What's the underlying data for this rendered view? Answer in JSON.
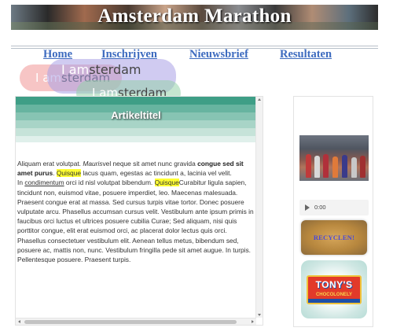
{
  "header": {
    "title": "Amsterdam Marathon"
  },
  "nav": {
    "items": [
      "Home",
      "Inschrijven",
      "Nieuwsbrief",
      "Resultaten"
    ]
  },
  "logo": {
    "prefix": "I am",
    "suffix": "sterdam"
  },
  "article": {
    "title": "Artikeltitel",
    "p1_a": "Aliquam erat volutpat. ",
    "p1_italic": "Mauris",
    "p1_b": "vel neque sit amet nunc gravida ",
    "p1_bold": "congue sed sit amet purus",
    "p1_c": ". ",
    "p1_hl1": "Quisque",
    "p1_d": " lacus quam, egestas ac tincidunt a, lacinia vel velit.",
    "p2_a": "In ",
    "p2_under": "condimentum",
    "p2_b": " orci id nisl volutpat bibendum. ",
    "p2_hl2": "Quisque",
    "p2_c": "Curabitur ligula sapien, tincidunt non, euismod vitae, posuere imperdiet, leo. Maecenas malesuada. Praesent congue erat at massa. Sed cursus turpis vitae tortor. Donec posuere vulputate arcu. Phasellus accumsan cursus velit. Vestibulum ante ipsum primis in faucibus orci luctus et ultrices posuere cubilia Curae; Sed aliquam, nisi quis porttitor congue, elit erat euismod orci, ac placerat dolor lectus quis orci. Phasellus consectetuer vestibulum elit. Aenean tellus metus, bibendum sed, posuere ac, mattis non, nunc. Vestibulum fringilla pede sit amet augue. In turpis. Pellentesque posuere. Praesent turpis."
  },
  "sidebar": {
    "audio_time": "0:00",
    "recycle_label": "RECYCLEN!",
    "tonys_brand": "TONY'S",
    "tonys_sub": "CHOCOLONELY"
  },
  "colors": {
    "nav_link": "#3d6bbf",
    "highlight": "#ffff33",
    "stripe_dark": "#3e9e86"
  }
}
